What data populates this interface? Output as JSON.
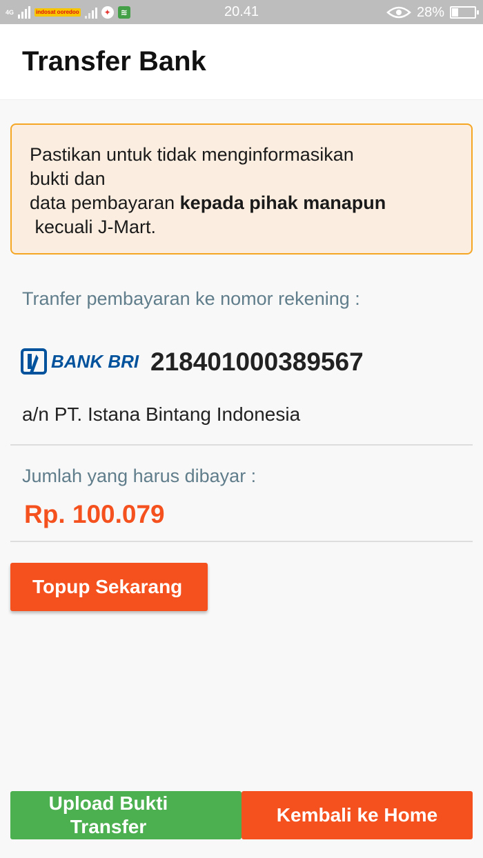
{
  "status_bar": {
    "network_label": "4G",
    "carrier": "indosat ooredoo",
    "time": "20.41",
    "battery_percent": "28%",
    "battery_level": 0.28
  },
  "header": {
    "title": "Transfer Bank"
  },
  "notice": {
    "line1": "Pastikan untuk tidak menginformasikan",
    "line2": "bukti dan",
    "line3_prefix": "data pembayaran ",
    "line3_bold": "kepada pihak manapun",
    "line4": " kecuali J-Mart."
  },
  "transfer": {
    "label": "Tranfer pembayaran ke nomor rekening :",
    "bank_name": "BANK BRI",
    "account_number": "218401000389567",
    "account_holder": "a/n PT. Istana Bintang Indonesia"
  },
  "payment": {
    "label": "Jumlah yang harus dibayar :",
    "amount": "Rp. 100.079"
  },
  "buttons": {
    "topup": "Topup Sekarang",
    "upload": "Upload Bukti Transfer",
    "home": "Kembali ke Home"
  },
  "colors": {
    "accent": "#f4511e",
    "success": "#4caf50",
    "notice_border": "#f5a623",
    "notice_bg": "#fbeee1",
    "bri_blue": "#00529c"
  }
}
